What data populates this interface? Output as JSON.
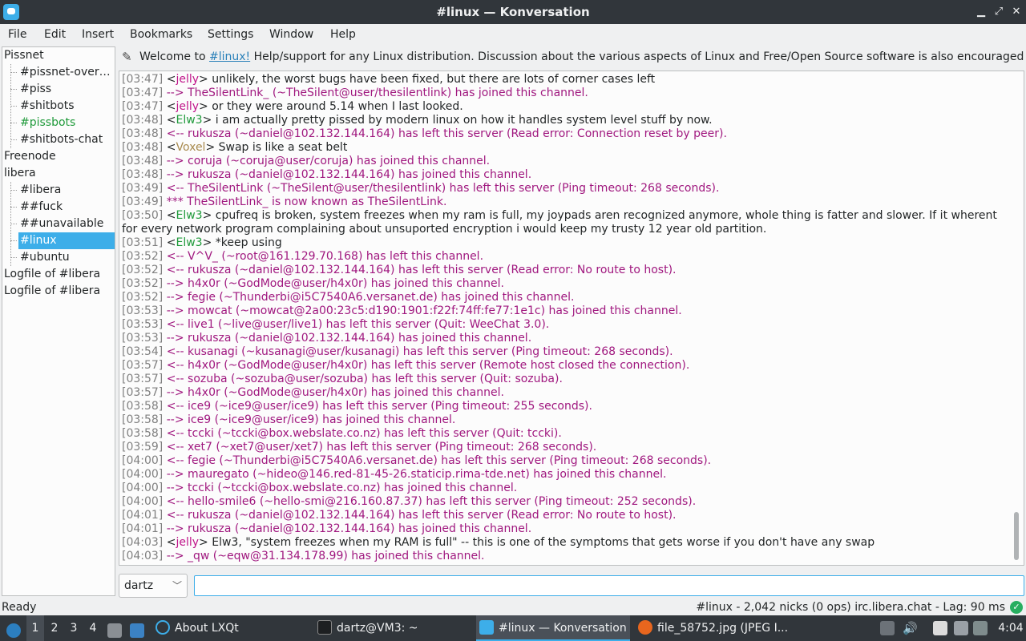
{
  "window": {
    "title": "#linux — Konversation"
  },
  "menu": [
    "File",
    "Edit",
    "Insert",
    "Bookmarks",
    "Settings",
    "Window",
    "Help"
  ],
  "tree": {
    "items": [
      {
        "label": "Pissnet",
        "level": 0
      },
      {
        "label": "#pissnet-over…",
        "level": 1
      },
      {
        "label": "#piss",
        "level": 1
      },
      {
        "label": "#shitbots",
        "level": 1
      },
      {
        "label": "#pissbots",
        "level": 1,
        "color": "#1f9a3a"
      },
      {
        "label": "#shitbots-chat",
        "level": 1
      },
      {
        "label": "Freenode",
        "level": 0
      },
      {
        "label": "libera",
        "level": 0
      },
      {
        "label": "#libera",
        "level": 1
      },
      {
        "label": "##fuck",
        "level": 1
      },
      {
        "label": "##unavailable",
        "level": 1
      },
      {
        "label": "#linux",
        "level": 1,
        "selected": true
      },
      {
        "label": "#ubuntu",
        "level": 1
      },
      {
        "label": "Logfile of #libera",
        "level": 0
      },
      {
        "label": "Logfile of #libera",
        "level": 0
      }
    ]
  },
  "topic": {
    "prefix": "Welcome to ",
    "link": "#linux!",
    "suffix": " Help/support for any Linux distribution. Discussion about the various aspects of Linux and Free/Open Source software is also encouraged. ..."
  },
  "chat": [
    {
      "ts": "[03:47]",
      "type": "msg",
      "nick": "jelly",
      "text": "unlikely, the worst bugs have been fixed, but there are lots of corner cases left"
    },
    {
      "ts": "[03:47]",
      "type": "sys",
      "text": "--> TheSilentLink_ (~TheSilent@user/thesilentlink) has joined this channel."
    },
    {
      "ts": "[03:47]",
      "type": "msg",
      "nick": "jelly",
      "text": "or they were around 5.14 when I last looked."
    },
    {
      "ts": "[03:48]",
      "type": "msg",
      "nick": "Elw3",
      "text": "i am actually pretty pissed by modern linux on how it handles system level stuff by now."
    },
    {
      "ts": "[03:48]",
      "type": "sys",
      "text": "<-- rukusza (~daniel@102.132.144.164) has left this server (Read error: Connection reset by peer)."
    },
    {
      "ts": "[03:48]",
      "type": "msg",
      "nick": "Voxel",
      "text": "Swap is like a seat belt"
    },
    {
      "ts": "[03:48]",
      "type": "sys",
      "text": "--> coruja (~coruja@user/coruja) has joined this channel."
    },
    {
      "ts": "[03:48]",
      "type": "sys",
      "text": "--> rukusza (~daniel@102.132.144.164) has joined this channel."
    },
    {
      "ts": "[03:49]",
      "type": "sys",
      "text": "<-- TheSilentLink (~TheSilent@user/thesilentlink) has left this server (Ping timeout: 268 seconds)."
    },
    {
      "ts": "[03:49]",
      "type": "sys",
      "text": "*** TheSilentLink_ is now known as TheSilentLink."
    },
    {
      "ts": "[03:50]",
      "type": "msg",
      "nick": "Elw3",
      "text": "cpufreq is broken, system freezes when my ram is full, my joypads aren recognized anymore, whole thing is fatter and slower. If it wherent for every network program complaining about unsuported encryption i would keep my trusty 12 year old partition."
    },
    {
      "ts": "[03:51]",
      "type": "msg",
      "nick": "Elw3",
      "text": "*keep using"
    },
    {
      "ts": "[03:52]",
      "type": "sys",
      "text": "<-- V^V_ (~root@161.129.70.168) has left this channel."
    },
    {
      "ts": "[03:52]",
      "type": "sys",
      "text": "<-- rukusza (~daniel@102.132.144.164) has left this server (Read error: No route to host)."
    },
    {
      "ts": "[03:52]",
      "type": "sys",
      "text": "--> h4x0r (~GodMode@user/h4x0r) has joined this channel."
    },
    {
      "ts": "[03:52]",
      "type": "sys",
      "text": "--> fegie (~Thunderbi@i5C7540A6.versanet.de) has joined this channel."
    },
    {
      "ts": "[03:53]",
      "type": "sys",
      "text": "--> mowcat (~mowcat@2a00:23c5:d190:1901:f22f:74ff:fe77:1e1c) has joined this channel."
    },
    {
      "ts": "[03:53]",
      "type": "sys",
      "text": "<-- live1 (~live@user/live1) has left this server (Quit: WeeChat 3.0)."
    },
    {
      "ts": "[03:53]",
      "type": "sys",
      "text": "--> rukusza (~daniel@102.132.144.164) has joined this channel."
    },
    {
      "ts": "[03:54]",
      "type": "sys",
      "text": "<-- kusanagi (~kusanagi@user/kusanagi) has left this server (Ping timeout: 268 seconds)."
    },
    {
      "ts": "[03:57]",
      "type": "sys",
      "text": "<-- h4x0r (~GodMode@user/h4x0r) has left this server (Remote host closed the connection)."
    },
    {
      "ts": "[03:57]",
      "type": "sys",
      "text": "<-- sozuba (~sozuba@user/sozuba) has left this server (Quit: sozuba)."
    },
    {
      "ts": "[03:57]",
      "type": "sys",
      "text": "--> h4x0r (~GodMode@user/h4x0r) has joined this channel."
    },
    {
      "ts": "[03:58]",
      "type": "sys",
      "text": "<-- ice9 (~ice9@user/ice9) has left this server (Ping timeout: 255 seconds)."
    },
    {
      "ts": "[03:58]",
      "type": "sys",
      "text": "--> ice9 (~ice9@user/ice9) has joined this channel."
    },
    {
      "ts": "[03:58]",
      "type": "sys",
      "text": "<-- tccki (~tccki@box.webslate.co.nz) has left this server (Quit: tccki)."
    },
    {
      "ts": "[03:59]",
      "type": "sys",
      "text": "<-- xet7 (~xet7@user/xet7) has left this server (Ping timeout: 268 seconds)."
    },
    {
      "ts": "[04:00]",
      "type": "sys",
      "text": "<-- fegie (~Thunderbi@i5C7540A6.versanet.de) has left this server (Ping timeout: 268 seconds)."
    },
    {
      "ts": "[04:00]",
      "type": "sys",
      "text": "--> mauregato (~hideo@146.red-81-45-26.staticip.rima-tde.net) has joined this channel."
    },
    {
      "ts": "[04:00]",
      "type": "sys",
      "text": "--> tccki (~tccki@box.webslate.co.nz) has joined this channel."
    },
    {
      "ts": "[04:00]",
      "type": "sys",
      "text": "<-- hello-smile6 (~hello-smi@216.160.87.37) has left this server (Ping timeout: 252 seconds)."
    },
    {
      "ts": "[04:01]",
      "type": "sys",
      "text": "<-- rukusza (~daniel@102.132.144.164) has left this server (Read error: No route to host)."
    },
    {
      "ts": "[04:01]",
      "type": "sys",
      "text": "--> rukusza (~daniel@102.132.144.164) has joined this channel."
    },
    {
      "ts": "[04:03]",
      "type": "msg",
      "nick": "jelly",
      "text": "Elw3, \"system freezes when my RAM is full\" -- this is one of the symptoms that gets worse if you don't have any swap"
    },
    {
      "ts": "[04:03]",
      "type": "sys",
      "text": "--> _qw (~eqw@31.134.178.99) has joined this channel."
    }
  ],
  "input": {
    "nick": "dartz",
    "value": ""
  },
  "status": {
    "left": "Ready",
    "right": "#linux - 2,042 nicks (0 ops)  irc.libera.chat - Lag: 90 ms"
  },
  "taskbar": {
    "desktops": [
      "1",
      "2",
      "3",
      "4"
    ],
    "tasks": [
      {
        "label": "About LXQt",
        "icon": "lxqt-icon",
        "active": false
      },
      {
        "label": "dartz@VM3: ~",
        "icon": "terminal-icon",
        "active": false
      },
      {
        "label": "#linux — Konversation",
        "icon": "konversation-icon",
        "active": true
      },
      {
        "label": "file_58752.jpg (JPEG I...",
        "icon": "firefox-icon",
        "active": false
      }
    ],
    "clock": "4:04"
  },
  "colors": {
    "accent": "#3daee9",
    "titlebar": "#31363b",
    "system_msg": "#a0187f",
    "timestamp": "#808080"
  }
}
